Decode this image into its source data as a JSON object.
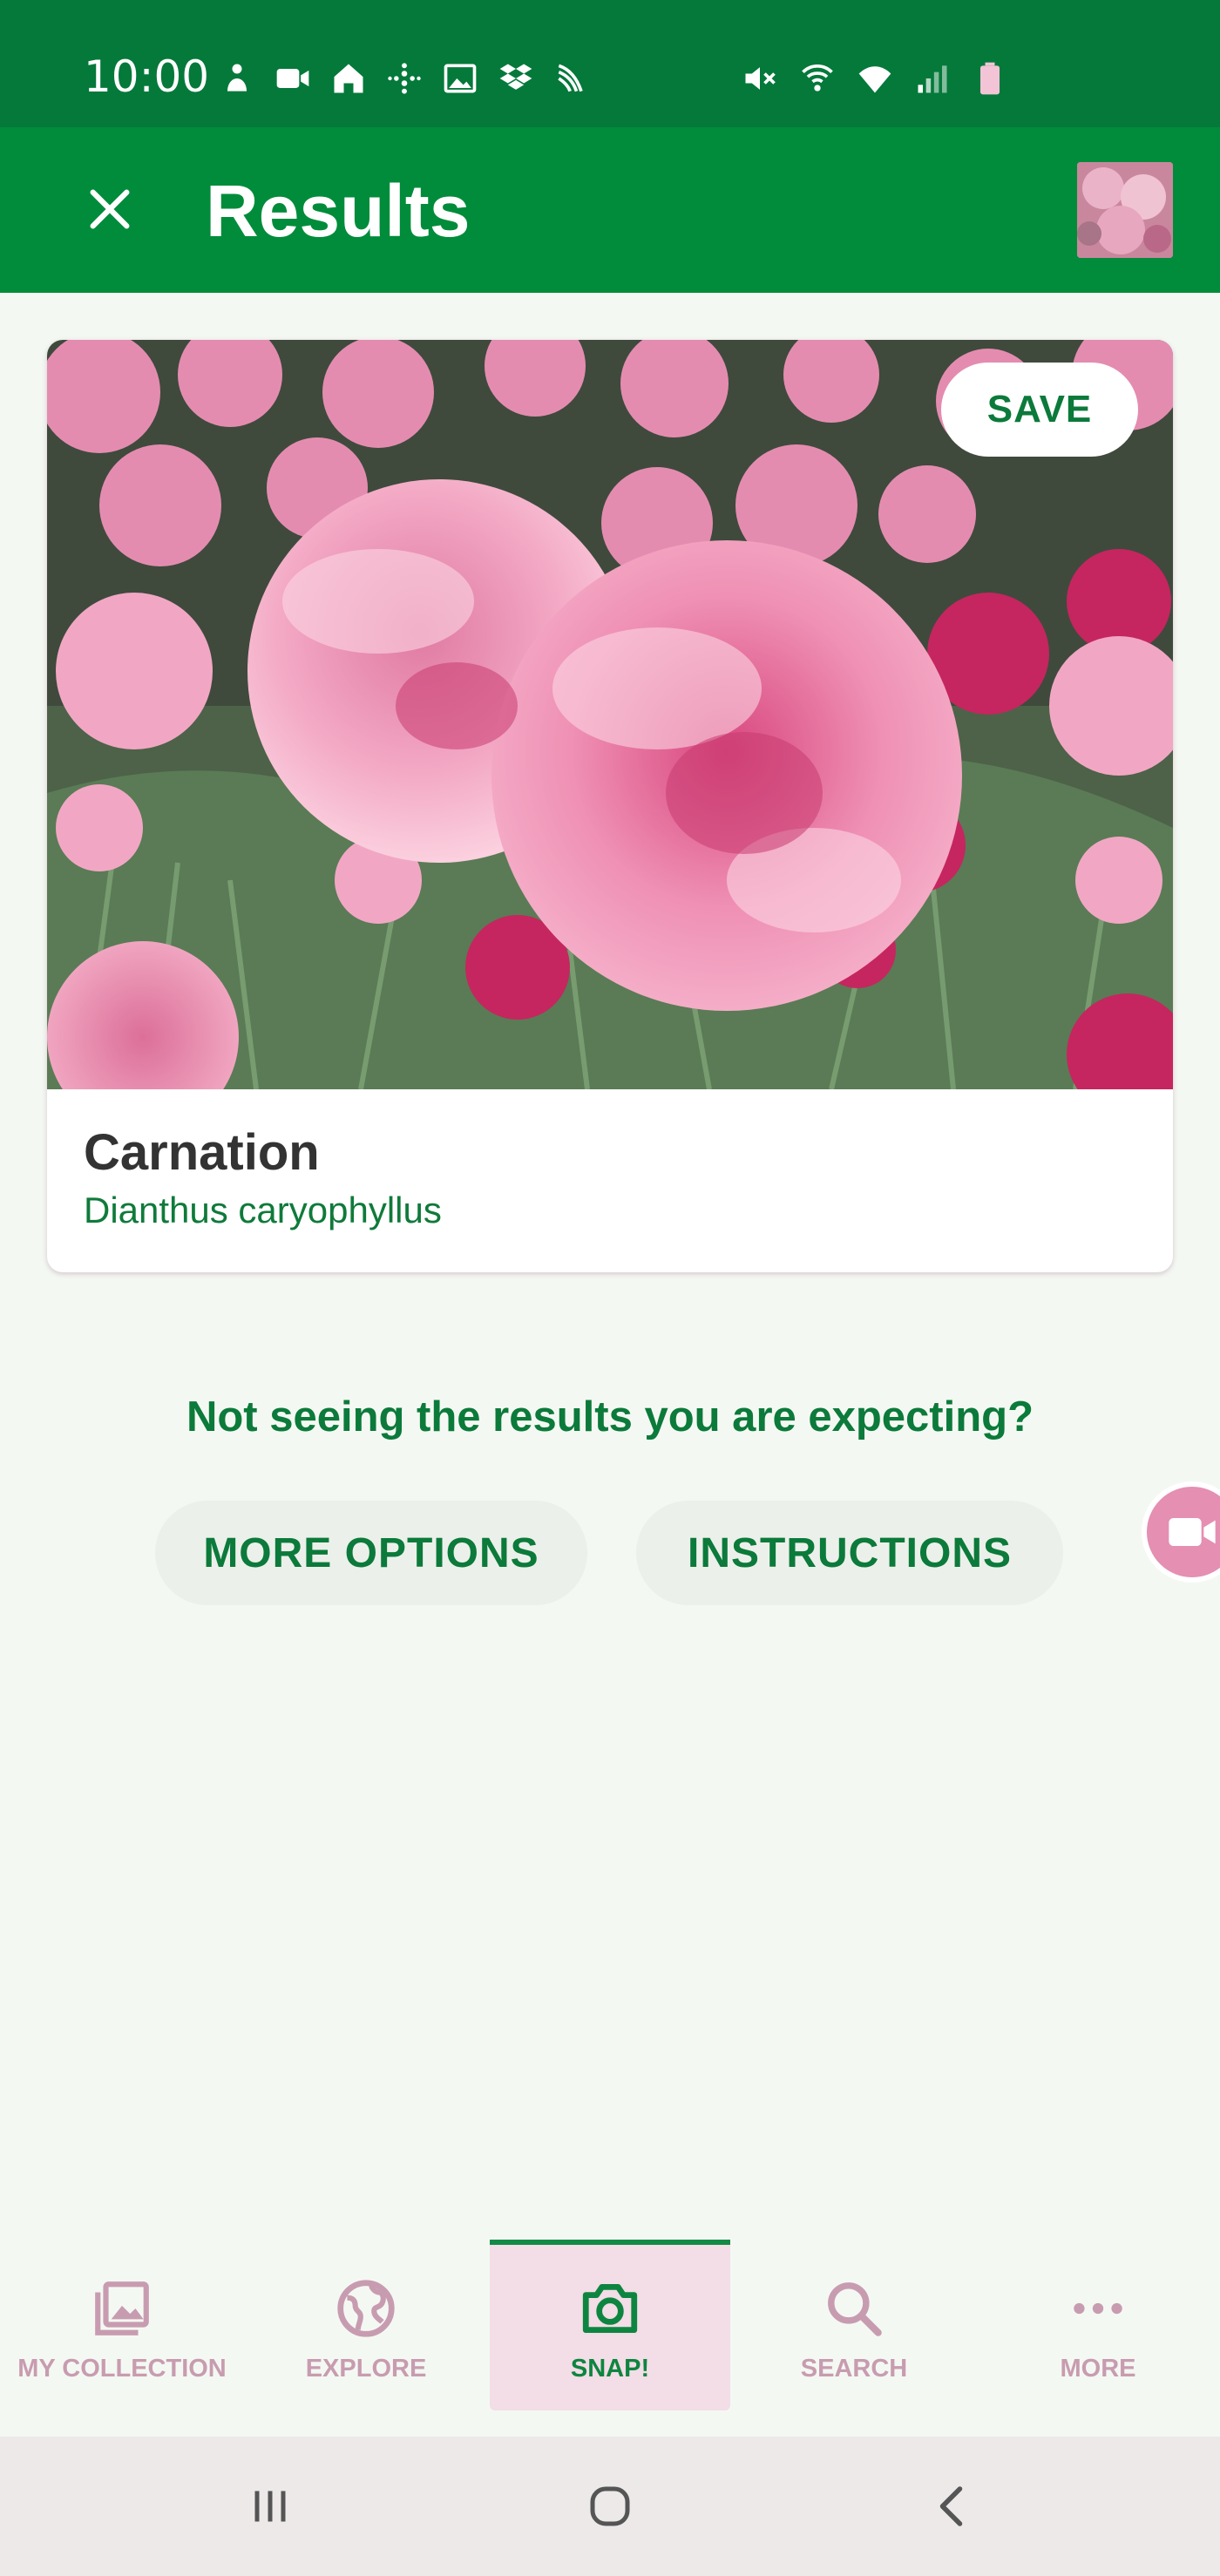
{
  "status_bar": {
    "time": "10:00",
    "left_icons": [
      "person-icon",
      "video-call-icon",
      "home-icon",
      "fitbit-icon",
      "image-icon",
      "dropbox-icon",
      "sprint-icon"
    ],
    "right_icons": [
      "mute-icon",
      "wifi-calling-icon",
      "wifi-icon",
      "signal-icon",
      "battery-icon"
    ]
  },
  "app_bar": {
    "title": "Results",
    "close_icon": "close-icon"
  },
  "result": {
    "save_label": "SAVE",
    "common_name": "Carnation",
    "scientific_name": "Dianthus caryophyllus"
  },
  "help": {
    "prompt": "Not seeing the results you are expecting?",
    "more_options_label": "MORE OPTIONS",
    "instructions_label": "INSTRUCTIONS"
  },
  "bottom_nav": {
    "items": [
      {
        "label": "MY COLLECTION",
        "icon": "gallery-icon"
      },
      {
        "label": "EXPLORE",
        "icon": "globe-icon"
      },
      {
        "label": "SNAP!",
        "icon": "camera-icon",
        "active": true
      },
      {
        "label": "SEARCH",
        "icon": "search-icon"
      },
      {
        "label": "MORE",
        "icon": "more-horizontal-icon"
      }
    ]
  },
  "colors": {
    "status_bar": "#04793a",
    "app_bar": "#008c3a",
    "accent_green": "#0b7a3a",
    "nav_inactive": "#c89cb0",
    "nav_active_bg": "#f3dde6",
    "background": "#f4f8f3"
  }
}
